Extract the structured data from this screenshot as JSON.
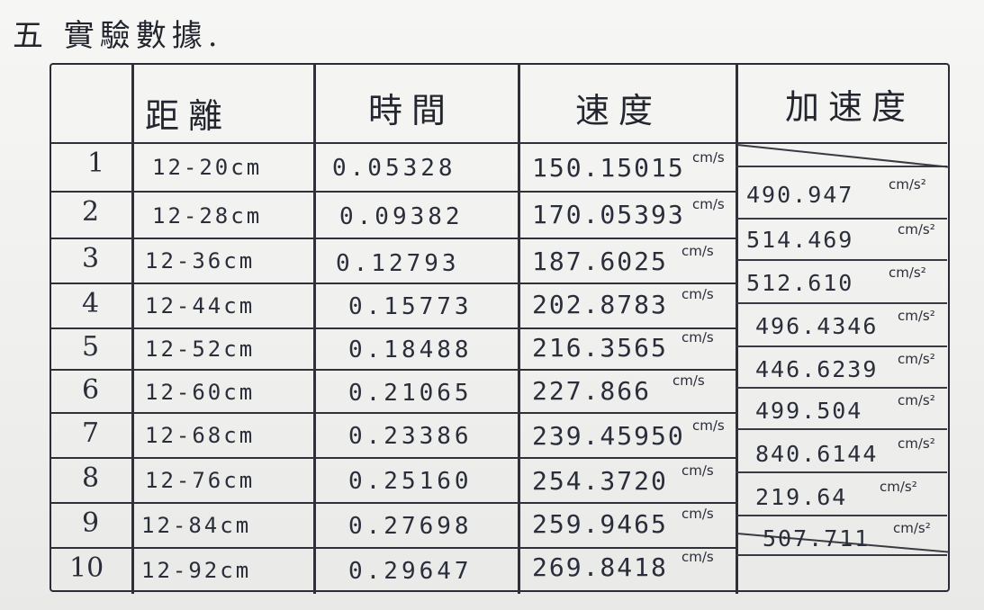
{
  "title": "五 實驗數據.",
  "headers": {
    "col_index": "",
    "col_distance": "距離",
    "col_time": "時間",
    "col_speed": "速度",
    "col_accel": "加速度"
  },
  "rows": [
    {
      "n": "1",
      "distance": "12-20cm",
      "time": "0.05328",
      "speed": "150.15015",
      "speed_unit": "cm/s"
    },
    {
      "n": "2",
      "distance": "12-28cm",
      "time": "0.09382",
      "speed": "170.05393",
      "speed_unit": "cm/s"
    },
    {
      "n": "3",
      "distance": "12-36cm",
      "time": "0.12793",
      "speed": "187.6025",
      "speed_unit": "cm/s"
    },
    {
      "n": "4",
      "distance": "12-44cm",
      "time": "0.15773",
      "speed": "202.8783",
      "speed_unit": "cm/s"
    },
    {
      "n": "5",
      "distance": "12-52cm",
      "time": "0.18488",
      "speed": "216.3565",
      "speed_unit": "cm/s"
    },
    {
      "n": "6",
      "distance": "12-60cm",
      "time": "0.21065",
      "speed": "227.866",
      "speed_unit": "cm/s"
    },
    {
      "n": "7",
      "distance": "12-68cm",
      "time": "0.23386",
      "speed": "239.45950",
      "speed_unit": "cm/s"
    },
    {
      "n": "8",
      "distance": "12-76cm",
      "time": "0.25160",
      "speed": "254.3720",
      "speed_unit": "cm/s"
    },
    {
      "n": "9",
      "distance": "12-84cm",
      "time": "0.27698",
      "speed": "259.9465",
      "speed_unit": "cm/s"
    },
    {
      "n": "10",
      "distance": "12-92cm",
      "time": "0.29647",
      "speed": "269.8418",
      "speed_unit": "cm/s"
    }
  ],
  "accelerations": [
    {
      "value": "490.947",
      "unit": "cm/s²"
    },
    {
      "value": "514.469",
      "unit": "cm/s²"
    },
    {
      "value": "512.610",
      "unit": "cm/s²"
    },
    {
      "value": "496.4346",
      "unit": "cm/s²"
    },
    {
      "value": "446.6239",
      "unit": "cm/s²"
    },
    {
      "value": "499.504",
      "unit": "cm/s²"
    },
    {
      "value": "840.6144",
      "unit": "cm/s²"
    },
    {
      "value": "219.64",
      "unit": "cm/s²"
    },
    {
      "value": "507.711",
      "unit": "cm/s²"
    }
  ]
}
